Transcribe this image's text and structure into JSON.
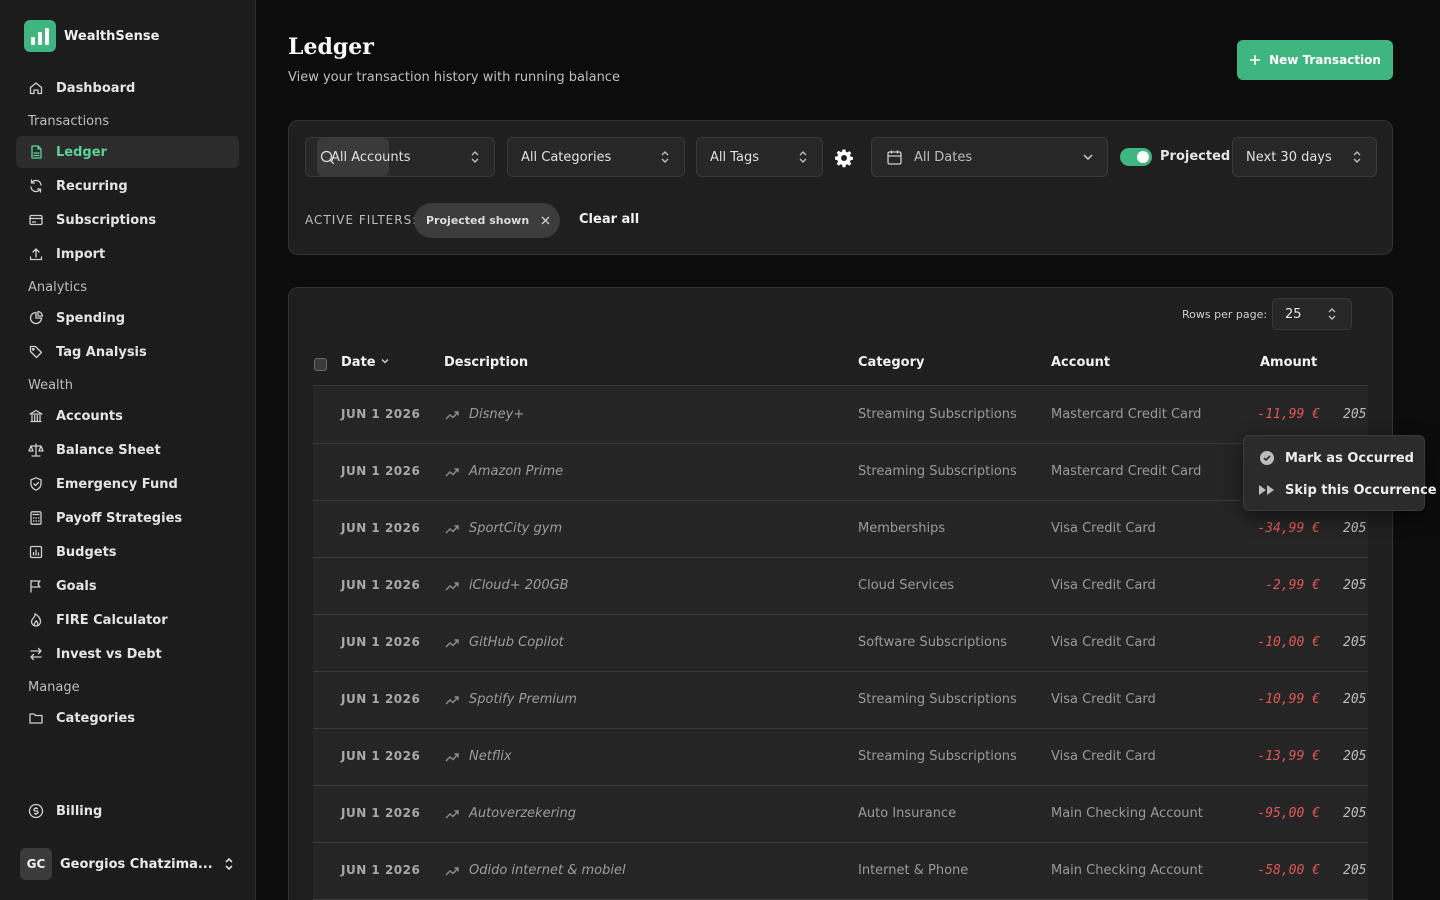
{
  "app": {
    "name": "WealthSense",
    "accent": "#3fb57f"
  },
  "sidebar": {
    "items": [
      {
        "type": "item",
        "label": "Dashboard",
        "icon": "home-icon"
      },
      {
        "type": "section",
        "label": "Transactions"
      },
      {
        "type": "item",
        "label": "Ledger",
        "icon": "ledger-icon",
        "active": true
      },
      {
        "type": "item",
        "label": "Recurring",
        "icon": "refresh-icon"
      },
      {
        "type": "item",
        "label": "Subscriptions",
        "icon": "card-icon"
      },
      {
        "type": "item",
        "label": "Import",
        "icon": "upload-icon"
      },
      {
        "type": "section",
        "label": "Analytics"
      },
      {
        "type": "item",
        "label": "Spending",
        "icon": "pie-chart-icon"
      },
      {
        "type": "item",
        "label": "Tag Analysis",
        "icon": "tag-icon"
      },
      {
        "type": "section",
        "label": "Wealth"
      },
      {
        "type": "item",
        "label": "Accounts",
        "icon": "bank-icon"
      },
      {
        "type": "item",
        "label": "Balance Sheet",
        "icon": "scale-icon"
      },
      {
        "type": "item",
        "label": "Emergency Fund",
        "icon": "shield-icon"
      },
      {
        "type": "item",
        "label": "Payoff Strategies",
        "icon": "calculator-icon"
      },
      {
        "type": "item",
        "label": "Budgets",
        "icon": "budget-icon"
      },
      {
        "type": "item",
        "label": "Goals",
        "icon": "flag-icon"
      },
      {
        "type": "item",
        "label": "FIRE Calculator",
        "icon": "flame-icon"
      },
      {
        "type": "item",
        "label": "Invest vs Debt",
        "icon": "swap-icon"
      },
      {
        "type": "section",
        "label": "Manage"
      },
      {
        "type": "item",
        "label": "Categories",
        "icon": "folder-icon"
      }
    ],
    "billing": {
      "label": "Billing",
      "icon": "dollar-circle-icon"
    },
    "user": {
      "initials": "GC",
      "name": "Georgios Chatzima..."
    }
  },
  "header": {
    "title": "Ledger",
    "subtitle": "View your transaction history with running balance",
    "new_button": "New Transaction"
  },
  "filters": {
    "accounts": "All Accounts",
    "categories": "All Categories",
    "tags": "All Tags",
    "dates": "All Dates",
    "projected_label": "Projected",
    "projected_on": true,
    "range": "Next 30 days",
    "active_label": "ACTIVE FILTERS:",
    "chip": "Projected shown",
    "clear": "Clear all"
  },
  "table": {
    "rows_per_page_label": "Rows per page:",
    "rows_per_page": "25",
    "columns": {
      "date": "Date",
      "description": "Description",
      "category": "Category",
      "account": "Account",
      "amount": "Amount"
    },
    "rows": [
      {
        "date": "JUN 1  2026",
        "description": "Disney+",
        "category": "Streaming Subscriptions",
        "account": "Mastercard Credit Card",
        "amount": "-11,99 €",
        "balance": "205"
      },
      {
        "date": "JUN 1  2026",
        "description": "Amazon Prime",
        "category": "Streaming Subscriptions",
        "account": "Mastercard Credit Card",
        "amount": "",
        "balance": ""
      },
      {
        "date": "JUN 1  2026",
        "description": "SportCity gym",
        "category": "Memberships",
        "account": "Visa Credit Card",
        "amount": "-34,99 €",
        "balance": "205"
      },
      {
        "date": "JUN 1  2026",
        "description": "iCloud+ 200GB",
        "category": "Cloud Services",
        "account": "Visa Credit Card",
        "amount": "-2,99 €",
        "balance": "205"
      },
      {
        "date": "JUN 1  2026",
        "description": "GitHub Copilot",
        "category": "Software Subscriptions",
        "account": "Visa Credit Card",
        "amount": "-10,00 €",
        "balance": "205"
      },
      {
        "date": "JUN 1  2026",
        "description": "Spotify Premium",
        "category": "Streaming Subscriptions",
        "account": "Visa Credit Card",
        "amount": "-10,99 €",
        "balance": "205"
      },
      {
        "date": "JUN 1  2026",
        "description": "Netflix",
        "category": "Streaming Subscriptions",
        "account": "Visa Credit Card",
        "amount": "-13,99 €",
        "balance": "205"
      },
      {
        "date": "JUN 1  2026",
        "description": "Autoverzekering",
        "category": "Auto Insurance",
        "account": "Main Checking Account",
        "amount": "-95,00 €",
        "balance": "205"
      },
      {
        "date": "JUN 1  2026",
        "description": "Odido internet & mobiel",
        "category": "Internet & Phone",
        "account": "Main Checking Account",
        "amount": "-58,00 €",
        "balance": "205"
      }
    ]
  },
  "context_menu": {
    "mark_occurred": "Mark as Occurred",
    "skip": "Skip this Occurrence"
  }
}
